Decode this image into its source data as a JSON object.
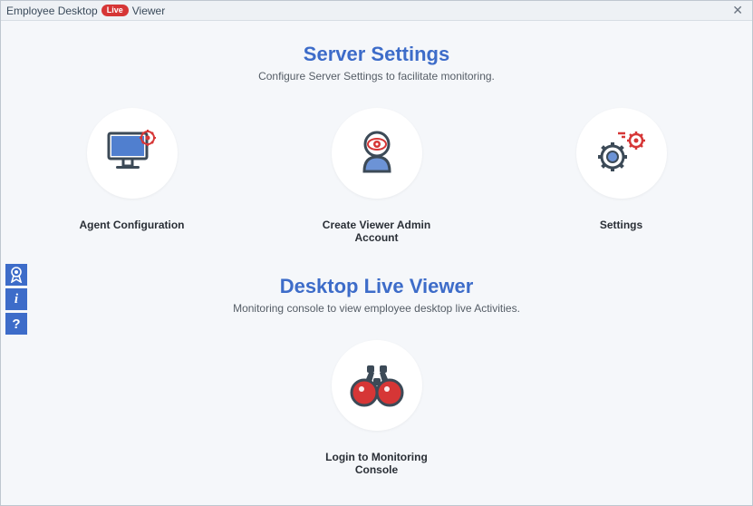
{
  "title": {
    "pre": "Employee Desktop",
    "badge": "Live",
    "post": "Viewer"
  },
  "section1": {
    "title": "Server Settings",
    "subtitle": "Configure Server Settings to facilitate monitoring."
  },
  "tiles": {
    "agent": "Agent Configuration",
    "admin": "Create Viewer Admin Account",
    "settings": "Settings"
  },
  "section2": {
    "title": "Desktop Live Viewer",
    "subtitle": "Monitoring console to view employee desktop live Activities."
  },
  "tile_login": "Login to Monitoring Console",
  "sidebar": {
    "award": "award",
    "info": "i",
    "help": "?"
  }
}
